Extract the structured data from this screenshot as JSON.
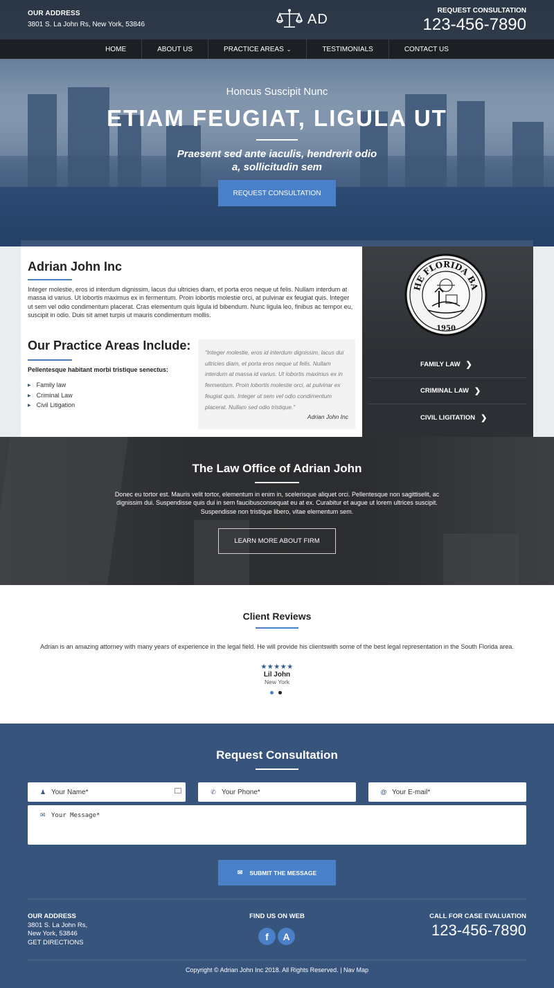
{
  "header": {
    "address_title": "OUR ADDRESS",
    "address_text": "3801 S. La John Rs, New York, 53846",
    "logo_text": "AD",
    "consult_title": "REQUEST CONSULTATION",
    "phone": "123-456-7890"
  },
  "nav": {
    "items": [
      "HOME",
      "ABOUT US",
      "PRACTICE AREAS",
      "TESTIMONIALS",
      "CONTACT US"
    ]
  },
  "hero": {
    "subtitle": "Honcus Suscipit Nunc",
    "title": "ETIAM FEUGIAT, LIGULA UT",
    "tagline": "Praesent sed ante iaculis, hendrerit odio a, sollicitudin sem",
    "button": "REQUEST CONSULTATION"
  },
  "about": {
    "title": "Adrian John Inc",
    "text": "Integer molestie, eros id interdum dignissim, lacus dui ultricies diam, et porta eros neque ut felis. Nullam interdum at massa id varius. Ut lobortis maximus ex in fermentum. Proin lobortis molestie orci, at pulvinar ex feugiat quis. Integer ut sem vel odio condimentum placerat. Cras elementum quis ligula id bibendum. Nunc ligula leo, finibus ac tempor eu, suscipit in odio. Duis sit amet turpis ut mauris condimentum mollis.",
    "practice_title": "Our Practice Areas Include:",
    "practice_sub": "Pellentesque habitant morbi tristique senectus:",
    "practice_items": [
      "Family law",
      "Criminal Law",
      "Civil Litigation"
    ],
    "quote_text": "\"Integer molestie, eros id interdum dignissim, lacus dui ultricies diam, et porta eros neque ut felis. Nullam interdum at massa id varius. Ut lobortis maximus ex in fermentum. Proin lobortis molestie orci, at pulvinar ex feugiat quis. Integer ut sem vel odio condimentum placerat. Nullam sed odio tristique.\"",
    "quote_author": "Adrian John Inc"
  },
  "side_menu": {
    "seal_text": "THE FLORIDA BAR",
    "seal_year": "1950",
    "items": [
      "FAMILY LAW",
      "CRIMINAL LAW",
      "CIVIL LIGITATION"
    ]
  },
  "office": {
    "title": "The Law Office of Adrian John",
    "text": "Donec eu tortor est. Mauris velit tortor, elementum in enim in, scelerisque aliquet orci. Pellentesque non sagittiselit, ac dignissim dui. Suspendisse quis dui in sem faucibusconsequat eu at ex. Curabitur et augue ut lorem ultrices suscipit. Suspendisse non tristique libero, vitae elementum sem.",
    "button": "LEARN MORE ABOUT FIRM"
  },
  "reviews": {
    "title": "Client Reviews",
    "text": "Adrian is an amazing attorney with many years of experience in the legal field. He will provide his clientswith some of the best legal representation in the South Florida area.",
    "rating": 5,
    "stars": "★★★★★",
    "name": "Lil John",
    "location": "New York",
    "dot_colors": [
      "#4a80c8",
      "#222222"
    ]
  },
  "form": {
    "title": "Request Consultation",
    "name_placeholder": "Your Name*",
    "phone_placeholder": "Your Phone*",
    "email_placeholder": "Your E-mail*",
    "message_placeholder": "Your Message*",
    "submit": "SUBMIT THE MESSAGE"
  },
  "footer": {
    "address_title": "OUR ADDRESS",
    "address_line1": "3801 S. La John Rs,",
    "address_line2": "New York, 53846",
    "directions": "GET DIRECTIONS",
    "web_title": "FIND US ON WEB",
    "social": [
      "f",
      "A"
    ],
    "call_title": "CALL FOR CASE EVALUATION",
    "phone": "123-456-7890",
    "copyright": "Copyright © Adrian John Inc 2018. All Rights Reserved. | Nav Map"
  },
  "colors": {
    "accent": "#4a80c8",
    "navy": "#37547c",
    "dark": "#1c1f23"
  }
}
